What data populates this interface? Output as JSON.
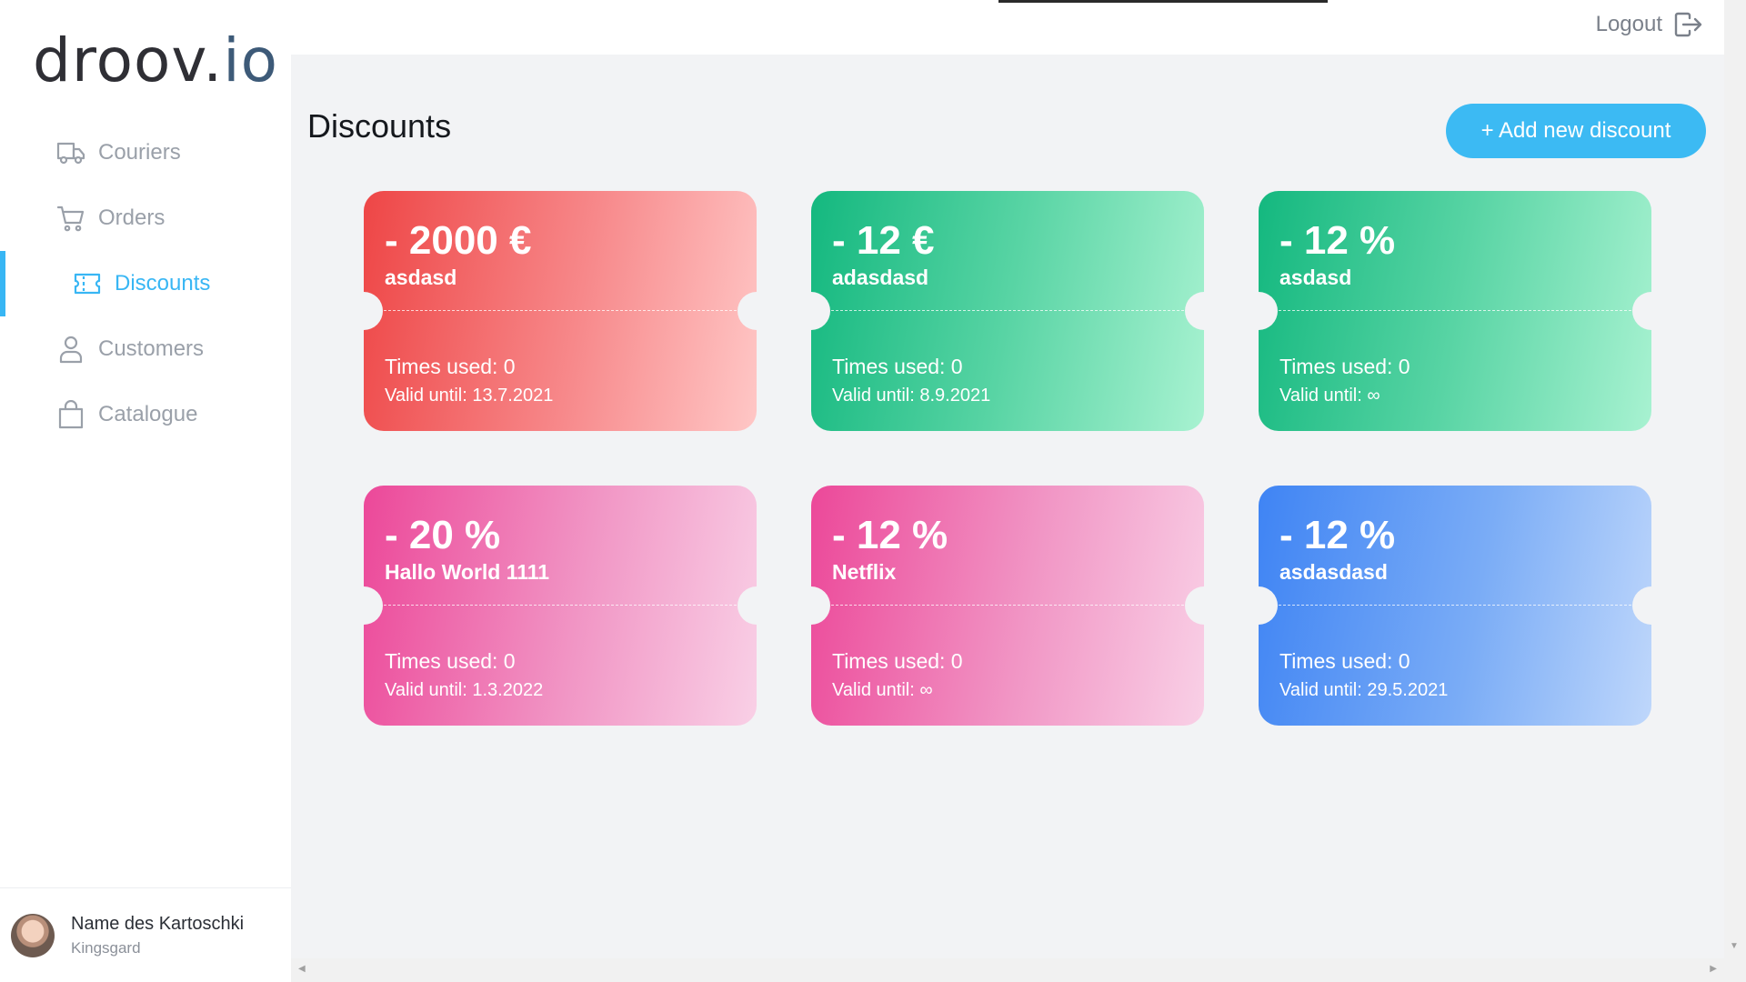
{
  "app": {
    "logo_part1": "droov.",
    "logo_part2": "io"
  },
  "sidebar": {
    "items": [
      {
        "label": "Couriers",
        "icon": "truck-icon",
        "active": false
      },
      {
        "label": "Orders",
        "icon": "cart-icon",
        "active": false
      },
      {
        "label": "Discounts",
        "icon": "ticket-icon",
        "active": true
      },
      {
        "label": "Customers",
        "icon": "person-icon",
        "active": false
      },
      {
        "label": "Catalogue",
        "icon": "bag-icon",
        "active": false
      }
    ],
    "user": {
      "name": "Name des Kartoschki",
      "company": "Kingsgard"
    }
  },
  "header": {
    "logout_label": "Logout"
  },
  "main": {
    "title": "Discounts",
    "add_button_label": "+ Add new discount",
    "discounts": [
      {
        "amount": "- 2000 €",
        "name": "asdasd",
        "times_used": "Times used: 0",
        "valid_until": "Valid until: 13.7.2021",
        "color": "red"
      },
      {
        "amount": "- 12 €",
        "name": "adasdasd",
        "times_used": "Times used: 0",
        "valid_until": "Valid until: 8.9.2021",
        "color": "green"
      },
      {
        "amount": "- 12 %",
        "name": "asdasd",
        "times_used": "Times used: 0",
        "valid_until": "Valid until: ∞",
        "color": "green"
      },
      {
        "amount": "- 20 %",
        "name": "Hallo World 1111",
        "times_used": "Times used: 0",
        "valid_until": "Valid until: 1.3.2022",
        "color": "pink"
      },
      {
        "amount": "- 12 %",
        "name": "Netflix",
        "times_used": "Times used: 0",
        "valid_until": "Valid until: ∞",
        "color": "pink"
      },
      {
        "amount": "- 12 %",
        "name": "asdasdasd",
        "times_used": "Times used: 0",
        "valid_until": "Valid until: 29.5.2021",
        "color": "blue"
      }
    ]
  },
  "colors": {
    "accent": "#38b6f4",
    "red": "#ee4646",
    "green": "#14b87f",
    "pink": "#ec4899",
    "blue": "#3f84f4"
  }
}
